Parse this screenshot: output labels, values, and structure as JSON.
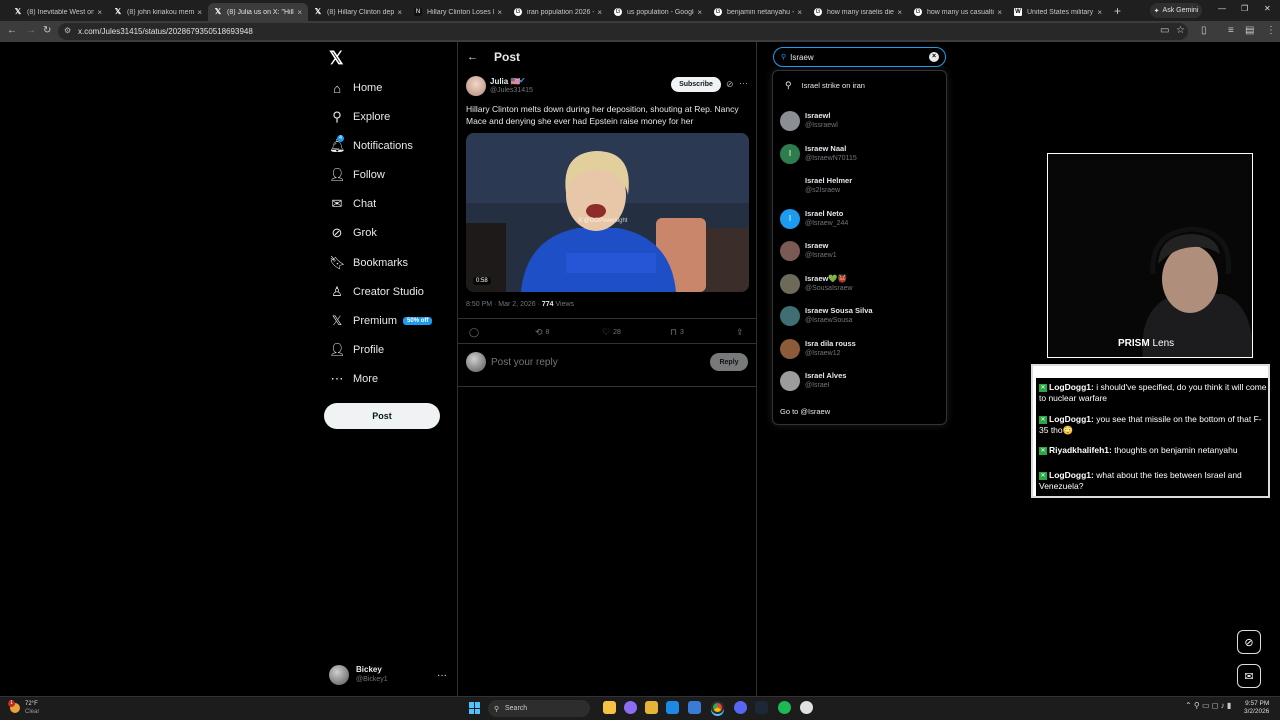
{
  "browser": {
    "tabs": [
      {
        "title": "(8) Inevitable West on X:",
        "icon": "x-icon"
      },
      {
        "title": "(8) john kiriakou meme",
        "icon": "x-icon"
      },
      {
        "title": "(8) Julia us on X: \"Hillary",
        "icon": "x-icon",
        "active": true
      },
      {
        "title": "(8) Hillary Clinton depo",
        "icon": "x-icon"
      },
      {
        "title": "Hillary Clinton Loses It D",
        "icon": "news-icon"
      },
      {
        "title": "iran population 2026 - G",
        "icon": "google-icon"
      },
      {
        "title": "us population - Google",
        "icon": "google-icon"
      },
      {
        "title": "benjamin netanyahu - G",
        "icon": "google-icon"
      },
      {
        "title": "how many israelis died",
        "icon": "google-icon"
      },
      {
        "title": "how many us casualties",
        "icon": "google-icon"
      },
      {
        "title": "United States military c",
        "icon": "wikipedia-icon"
      }
    ],
    "new_tab": "+",
    "ask_gemini": "Ask Gemini",
    "url": "x.com/Jules31415/status/2028679350518693948"
  },
  "sidebar": {
    "logo": "𝕏",
    "items": [
      {
        "label": "Home",
        "icon": "⌂"
      },
      {
        "label": "Explore",
        "icon": "⚲"
      },
      {
        "label": "Notifications",
        "icon": "🔔︎",
        "badge": "4"
      },
      {
        "label": "Follow",
        "icon": "👤︎"
      },
      {
        "label": "Chat",
        "icon": "✉"
      },
      {
        "label": "Grok",
        "icon": "⊘"
      },
      {
        "label": "Bookmarks",
        "icon": "🔖︎"
      },
      {
        "label": "Creator Studio",
        "icon": "♙"
      },
      {
        "label": "Premium",
        "icon": "𝕏",
        "pill": "50% off"
      },
      {
        "label": "Profile",
        "icon": "👤︎"
      },
      {
        "label": "More",
        "icon": "⋯"
      }
    ],
    "post_button": "Post",
    "account": {
      "name": "Bickey",
      "handle": "@Bickey1",
      "more": "···"
    }
  },
  "post": {
    "header_title": "Post",
    "author_name": "Julia 🇺🇸",
    "author_handle": "@Jules31415",
    "subscribe": "Subscribe",
    "text": "Hillary Clinton melts down during her deposition, shouting at Rep. Nancy Mace and denying she ever had Epstein raise money for her",
    "video_duration": "0:58",
    "video_watermark": "X @GOPoversight",
    "time": "8:50 PM · Mar 2, 2026 ·",
    "views": "774",
    "views_label": "Views",
    "actions": {
      "replies": "",
      "reposts": "8",
      "likes": "28",
      "bookmarks": "3"
    },
    "reply_placeholder": "Post your reply",
    "reply_button": "Reply"
  },
  "search": {
    "query": "Israew",
    "suggestion": "Israel strike on iran",
    "users": [
      {
        "name": "Israewl",
        "handle": "@Issraewl",
        "color": "#8b8f95",
        "initial": ""
      },
      {
        "name": "Israew Naal",
        "handle": "@IsraewN70115",
        "color": "#2e7d4f",
        "initial": "I"
      },
      {
        "name": "Israel Helmer",
        "handle": "@s2Israew",
        "color": "#000000",
        "initial": ""
      },
      {
        "name": "Israel Neto",
        "handle": "@Israew_244",
        "color": "#1d9bf0",
        "initial": "I"
      },
      {
        "name": "Israew",
        "handle": "@Israew1",
        "color": "#7a5a55",
        "initial": ""
      },
      {
        "name": "Israew💚👹",
        "handle": "@SousaIsraew",
        "color": "#6d6a5a",
        "initial": ""
      },
      {
        "name": "Israew Sousa Silva",
        "handle": "@IsraewSousa",
        "color": "#3f6e74",
        "initial": ""
      },
      {
        "name": "Isra dila rouss",
        "handle": "@Israew12",
        "color": "#8d5a3a",
        "initial": ""
      },
      {
        "name": "Israel Alves",
        "handle": "@IsraeI",
        "color": "#9c9c9c",
        "initial": ""
      }
    ],
    "goto": "Go to @Israew"
  },
  "overlay": {
    "cam_label_bold": "PRISM",
    "cam_label_rest": "Lens",
    "chat": [
      {
        "user": "LogDogg1:",
        "message": "i should've specified, do you think it will come to nuclear warfare"
      },
      {
        "user": "LogDogg1:",
        "message": "you see that missile on the bottom of that F-35 tho😳"
      },
      {
        "user": "Riyadkhalifeh1:",
        "message": "thoughts on benjamin netanyahu"
      },
      {
        "user": "LogDogg1:",
        "message": "what about the ties between Israel and Venezuela?"
      }
    ]
  },
  "taskbar": {
    "weather_temp": "72°F",
    "weather_desc": "Clear",
    "weather_badge": "1",
    "search": "Search",
    "time": "9:57 PM",
    "date": "3/2/2026"
  }
}
